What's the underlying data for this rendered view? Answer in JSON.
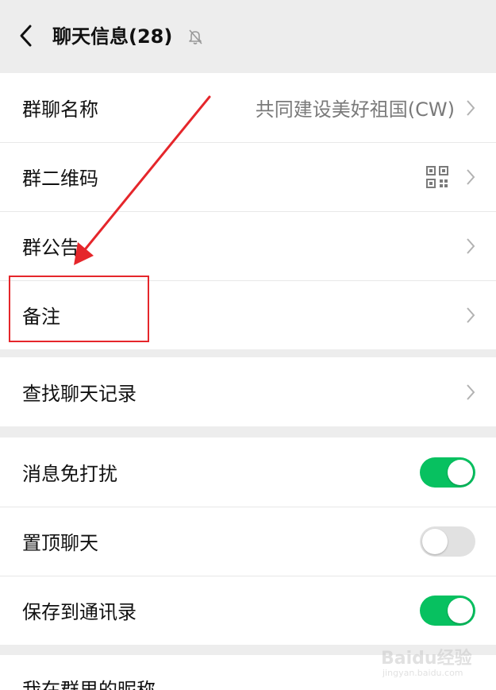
{
  "header": {
    "title": "聊天信息(28)",
    "back_icon": "chevron-left-icon",
    "mute_icon": "bell-off-icon"
  },
  "group_section": {
    "rows": [
      {
        "label": "群聊名称",
        "value": "共同建设美好祖国(CW)"
      },
      {
        "label": "群二维码",
        "icon": "qr-code-icon"
      },
      {
        "label": "群公告"
      },
      {
        "label": "备注"
      }
    ]
  },
  "search_section": {
    "label": "查找聊天记录"
  },
  "toggles_section": {
    "rows": [
      {
        "label": "消息免打扰",
        "on": true
      },
      {
        "label": "置顶聊天",
        "on": false
      },
      {
        "label": "保存到通讯录",
        "on": true
      }
    ]
  },
  "last_section": {
    "label": "我在群里的昵称"
  },
  "colors": {
    "background": "#ededed",
    "panel": "#ffffff",
    "toggle_on": "#07c160",
    "toggle_off": "#e1e1e1",
    "annotation_red": "#e5262b"
  },
  "watermark": {
    "text": "Baidu经验",
    "sub": "jingyan.baidu.com"
  }
}
